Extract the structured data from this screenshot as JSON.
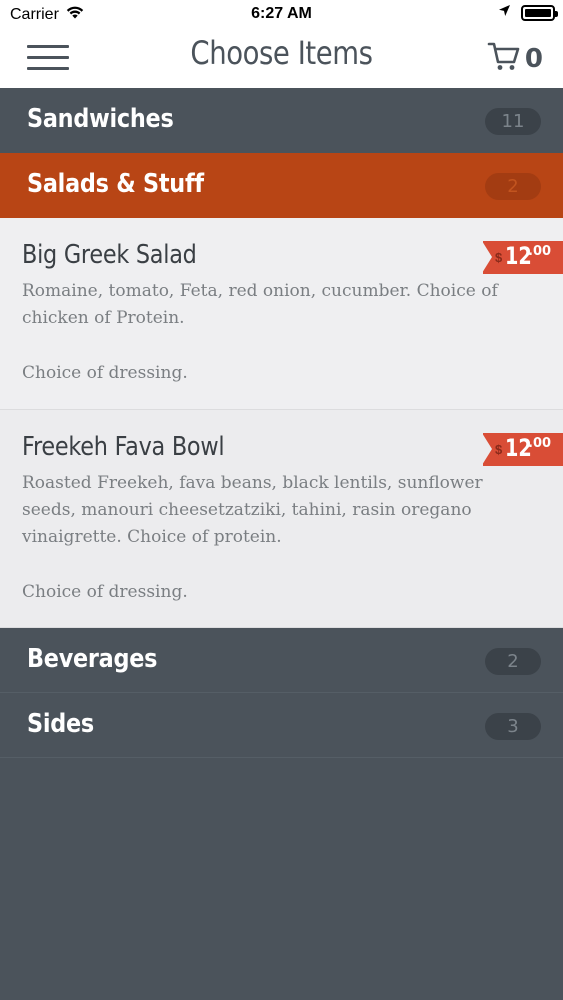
{
  "status_bar": {
    "carrier": "Carrier",
    "time": "6:27 AM"
  },
  "nav": {
    "title": "Choose Items",
    "cart_count": "0"
  },
  "categories": [
    {
      "label": "Sandwiches",
      "count": "11"
    },
    {
      "label": "Salads & Stuff",
      "count": "2"
    },
    {
      "label": "Beverages",
      "count": "2"
    },
    {
      "label": "Sides",
      "count": "3"
    }
  ],
  "items": [
    {
      "name": "Big Greek Salad",
      "description": "Romaine, tomato, Feta, red onion, cucumber. Choice of chicken of Protein.",
      "dressing": "Choice of dressing.",
      "price_currency": "$",
      "price_main": "12",
      "price_cents": ".00"
    },
    {
      "name": "Freekeh Fava Bowl",
      "description": "Roasted Freekeh, fava beans, black lentils, sunflower seeds, manouri cheesetzatziki, tahini, rasin oregano vinaigrette. Choice of protein.",
      "dressing": "Choice of dressing.",
      "price_currency": "$",
      "price_main": "12",
      "price_cents": ".00"
    }
  ],
  "colors": {
    "header_dark": "#4b535b",
    "accent": "#b84515",
    "price_tag": "#d94d36",
    "item_bg": "#efeff1"
  },
  "icons": {
    "menu": "hamburger-icon",
    "cart": "cart-icon",
    "wifi": "wifi-icon",
    "location": "location-arrow-icon",
    "battery": "battery-icon"
  }
}
